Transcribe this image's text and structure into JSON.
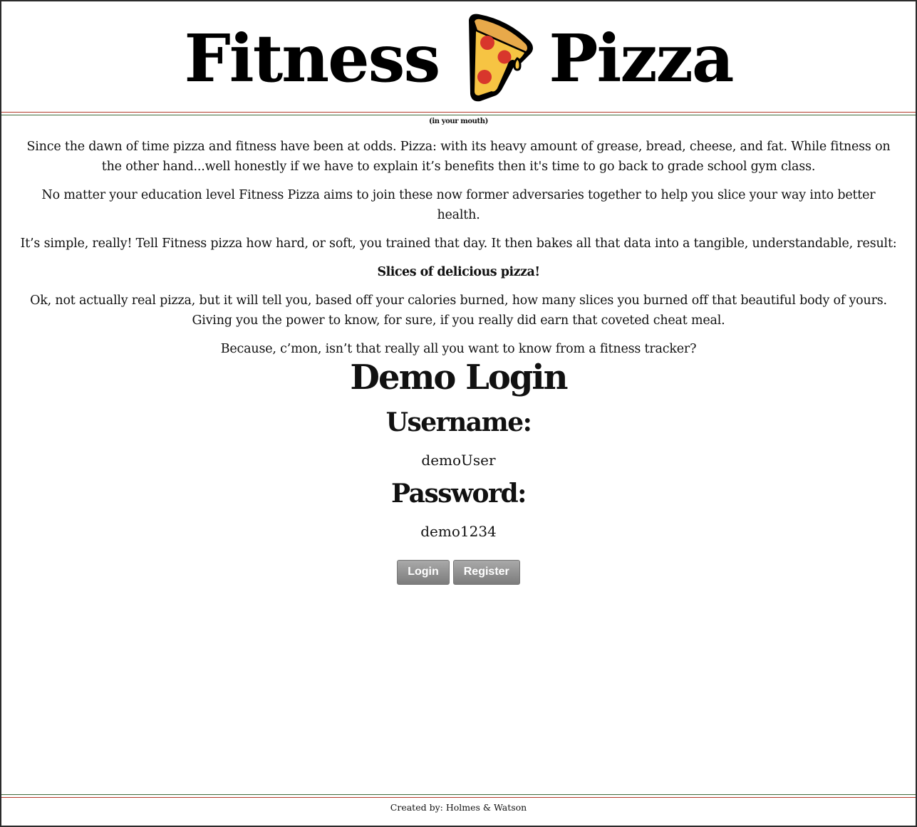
{
  "header": {
    "title_left": "Fitness",
    "title_right": "Pizza",
    "logo_icon": "pizza-slice-icon",
    "tagline": "(in your mouth)"
  },
  "intro": {
    "p1": "Since the dawn of time pizza and fitness have been at odds. Pizza: with its heavy amount of grease, bread, cheese, and fat. While fitness on the other hand...well honestly if we have to explain it’s benefits then it's time to go back to grade school gym class.",
    "p2": "No matter your education level Fitness Pizza aims to join these now former adversaries together to help you slice your way into better health.",
    "p3": "It’s simple, really! Tell Fitness pizza how hard, or soft, you trained that day. It then bakes all that data into a tangible, understandable, result:",
    "p4": "Slices of delicious pizza!",
    "p5": "Ok, not actually real pizza, but it will tell you, based off your calories burned, how many slices you burned off that beautiful body of yours. Giving you the power to know, for sure, if you really did earn that coveted cheat meal.",
    "p6": "Because, c’mon, isn’t that really all you want to know from a fitness tracker?"
  },
  "login": {
    "heading": "Demo Login",
    "username_label": "Username:",
    "username_value": "demoUser",
    "password_label": "Password:",
    "password_value": "demo1234",
    "login_button": "Login",
    "register_button": "Register"
  },
  "footer": {
    "credits": "Created by: Holmes & Watson"
  },
  "colors": {
    "rule_red": "#b33a2a",
    "rule_green": "#3f6b3a",
    "button_gray": "#8e8e8e"
  }
}
